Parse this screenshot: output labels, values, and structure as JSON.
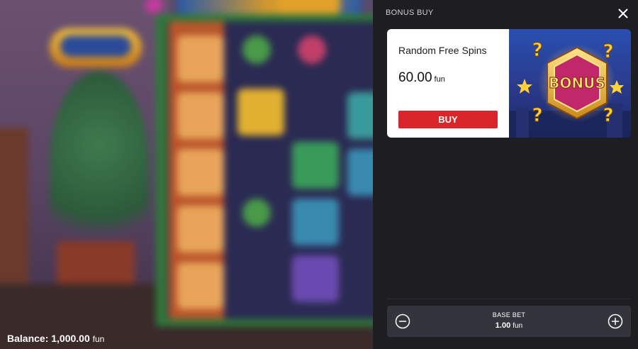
{
  "game": {
    "balance_label": "Balance:",
    "balance_value": "1,000.00",
    "balance_unit": "fun"
  },
  "panel": {
    "title": "BONUS BUY",
    "close_icon": "close-icon",
    "card": {
      "name": "Random Free Spins",
      "price": "60.00",
      "price_unit": "fun",
      "buy_label": "BUY",
      "image_text": "BONUS"
    },
    "bet": {
      "label": "BASE BET",
      "value": "1.00",
      "unit": "fun",
      "minus_icon": "minus-circle-icon",
      "plus_icon": "plus-circle-icon"
    }
  },
  "colors": {
    "panel_bg": "#1d1d22",
    "buy_button": "#d8262b",
    "bet_box": "#33343c"
  }
}
